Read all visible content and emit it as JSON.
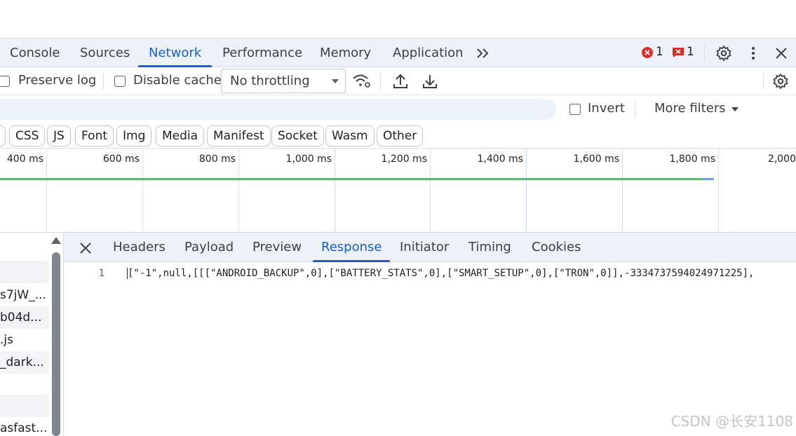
{
  "main_tabs": [
    "Console",
    "Sources",
    "Network",
    "Performance",
    "Memory",
    "Application"
  ],
  "active_main_tab": "Network",
  "status": {
    "errors": "1",
    "issues": "1"
  },
  "toolbar": {
    "preserve_log": "Preserve log",
    "disable_cache": "Disable cache",
    "throttling": "No throttling"
  },
  "filter": {
    "invert": "Invert",
    "more_filters": "More filters"
  },
  "type_chips": [
    "CSS",
    "JS",
    "Font",
    "Img",
    "Media",
    "Manifest",
    "Socket",
    "Wasm",
    "Other"
  ],
  "timeline_ticks": [
    "400 ms",
    "600 ms",
    "800 ms",
    "1,000 ms",
    "1,200 ms",
    "1,400 ms",
    "1,600 ms",
    "1,800 ms",
    "2,000"
  ],
  "request_list": [
    "s7jW_...",
    "b04d...",
    ".js",
    "_dark...",
    "asfast..."
  ],
  "detail_tabs": [
    "Headers",
    "Payload",
    "Preview",
    "Response",
    "Initiator",
    "Timing",
    "Cookies"
  ],
  "active_detail_tab": "Response",
  "response": {
    "line_number": "1",
    "line_text": "[\"-1\",null,[[[\"ANDROID_BACKUP\",0],[\"BATTERY_STATS\",0],[\"SMART_SETUP\",0],[\"TRON\",0]],-3334737594024971225],"
  },
  "watermark": "CSDN @长安1108",
  "colors": {
    "accent": "#1a5fcc",
    "tab_bg": "#edf2fa",
    "error_red": "#d93025",
    "timeline_green": "#5bb974",
    "timeline_blue": "#6b9cf4"
  }
}
